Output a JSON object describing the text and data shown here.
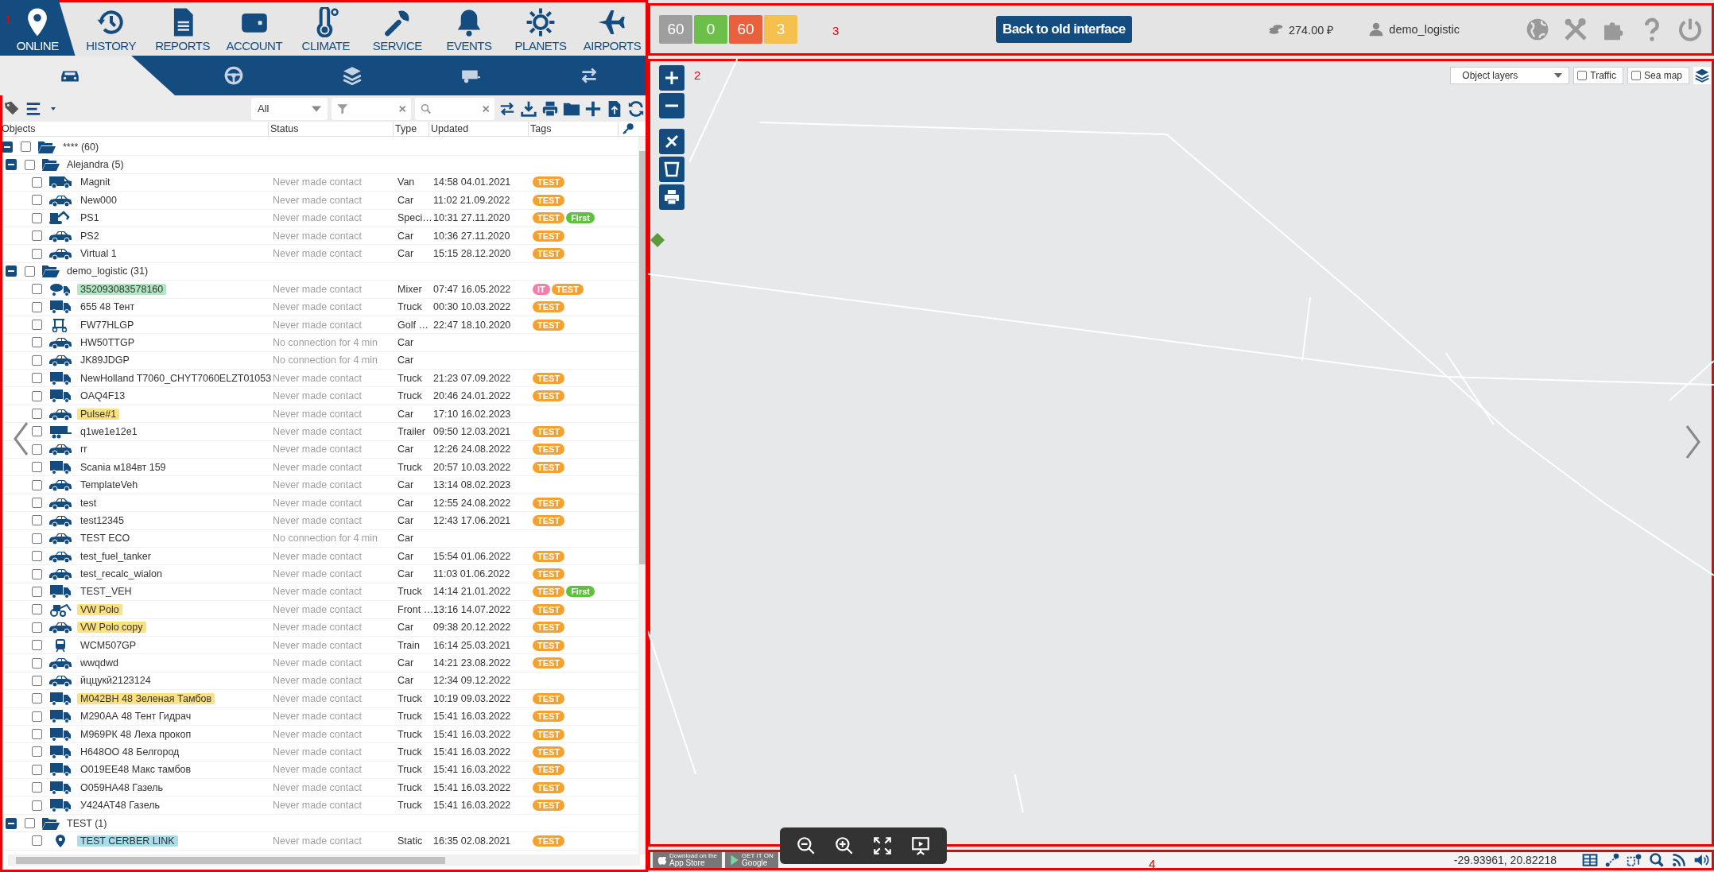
{
  "left_panel": {
    "annotation": "1",
    "nav": [
      {
        "label": "ONLINE",
        "selected": true
      },
      {
        "label": "HISTORY",
        "selected": false
      },
      {
        "label": "REPORTS",
        "selected": false
      },
      {
        "label": "ACCOUNT",
        "selected": false
      },
      {
        "label": "CLIMATE",
        "selected": false
      },
      {
        "label": "SERVICE",
        "selected": false
      },
      {
        "label": "EVENTS",
        "selected": false
      },
      {
        "label": "PLANETS",
        "selected": false
      },
      {
        "label": "AIRPORTS",
        "selected": false
      }
    ],
    "sub_tabs": [
      {
        "selected": true
      },
      {
        "selected": false
      },
      {
        "selected": false
      },
      {
        "selected": false
      },
      {
        "selected": false
      }
    ],
    "filter_select": {
      "value": "All"
    },
    "columns": [
      "Objects",
      "Status",
      "Type",
      "Updated",
      "Tags"
    ],
    "object_tree": [
      {
        "kind": "group",
        "name": "**** (60)",
        "expanded": true,
        "checked": false,
        "children": [
          {
            "kind": "group",
            "name": "Alejandra (5)",
            "expanded": true,
            "checked": false,
            "children": [
              {
                "kind": "van",
                "name": "Magnit",
                "checked": false,
                "status": "Never made contact",
                "type": "Van",
                "updated": "14:58 04.01.2021",
                "tags": [
                  {
                    "label": "TEST",
                    "color": "#f5a130"
                  }
                ]
              },
              {
                "kind": "car",
                "name": "New000",
                "checked": false,
                "status": "Never made contact",
                "type": "Car",
                "updated": "11:02 21.09.2022",
                "tags": [
                  {
                    "label": "TEST",
                    "color": "#f5a130"
                  }
                ]
              },
              {
                "kind": "excavator",
                "name": "PS1",
                "checked": false,
                "status": "Never made contact",
                "type": "Speci…",
                "updated": "10:31 27.11.2020",
                "tags": [
                  {
                    "label": "TEST",
                    "color": "#f5a130"
                  },
                  {
                    "label": "First",
                    "color": "#5cc23b"
                  }
                ]
              },
              {
                "kind": "car",
                "name": "PS2",
                "checked": false,
                "status": "Never made contact",
                "type": "Car",
                "updated": "10:36 27.11.2020",
                "tags": [
                  {
                    "label": "TEST",
                    "color": "#f5a130"
                  }
                ]
              },
              {
                "kind": "car",
                "name": "Virtual 1",
                "checked": false,
                "status": "Never made contact",
                "type": "Car",
                "updated": "15:15 28.12.2020",
                "tags": [
                  {
                    "label": "TEST",
                    "color": "#f5a130"
                  }
                ]
              }
            ]
          },
          {
            "kind": "group",
            "name": "demo_logistic (31)",
            "expanded": true,
            "checked": false,
            "children": [
              {
                "kind": "mixer",
                "name": "352093083578160",
                "color": "#b3e6c3",
                "checked": false,
                "status": "Never made contact",
                "type": "Mixer",
                "updated": "07:47 16.05.2022",
                "tags": [
                  {
                    "label": "IT",
                    "color": "#f27fa6"
                  },
                  {
                    "label": "TEST",
                    "color": "#f5a130"
                  }
                ]
              },
              {
                "kind": "truck",
                "name": "655 48 Тент",
                "checked": false,
                "status": "Never made contact",
                "type": "Truck",
                "updated": "00:30 10.03.2022",
                "tags": [
                  {
                    "label": "TEST",
                    "color": "#f5a130"
                  }
                ]
              },
              {
                "kind": "golf",
                "name": "FW77HLGP",
                "checked": false,
                "status": "Never made contact",
                "type": "Golf …",
                "updated": "22:47 18.10.2020",
                "tags": [
                  {
                    "label": "TEST",
                    "color": "#f5a130"
                  }
                ]
              },
              {
                "kind": "car",
                "name": "HW50TTGP",
                "checked": false,
                "status": "No connection for 4 min",
                "type": "Car"
              },
              {
                "kind": "car",
                "name": "JK89JDGP",
                "checked": false,
                "status": "No connection for 4 min",
                "type": "Car"
              },
              {
                "kind": "truck",
                "name": "NewHolland T7060_CHYT7060ELZT01053",
                "checked": false,
                "status": "Never made contact",
                "type": "Truck",
                "updated": "21:23 07.09.2022",
                "tags": [
                  {
                    "label": "TEST",
                    "color": "#f5a130"
                  }
                ]
              },
              {
                "kind": "truck",
                "name": "OAQ4F13",
                "checked": false,
                "status": "Never made contact",
                "type": "Truck",
                "updated": "20:46 24.01.2022",
                "tags": [
                  {
                    "label": "TEST",
                    "color": "#f5a130"
                  }
                ]
              },
              {
                "kind": "car",
                "name": "Pulse#1",
                "color": "#fbe27f",
                "checked": false,
                "status": "Never made contact",
                "type": "Car",
                "updated": "17:10 16.02.2023"
              },
              {
                "kind": "trailer",
                "name": "q1we1e12e1",
                "checked": false,
                "status": "Never made contact",
                "type": "Trailer",
                "updated": "09:50 12.03.2021",
                "tags": [
                  {
                    "label": "TEST",
                    "color": "#f5a130"
                  }
                ]
              },
              {
                "kind": "car",
                "name": "rr",
                "checked": false,
                "status": "Never made contact",
                "type": "Car",
                "updated": "12:26 24.08.2022",
                "tags": [
                  {
                    "label": "TEST",
                    "color": "#f5a130"
                  }
                ]
              },
              {
                "kind": "truck",
                "name": "Scania м184вт 159",
                "checked": false,
                "status": "Never made contact",
                "type": "Truck",
                "updated": "20:57 10.03.2022",
                "tags": [
                  {
                    "label": "TEST",
                    "color": "#f5a130"
                  }
                ]
              },
              {
                "kind": "car",
                "name": "TemplateVeh",
                "checked": false,
                "status": "Never made contact",
                "type": "Car",
                "updated": "13:14 08.02.2023"
              },
              {
                "kind": "car",
                "name": "test",
                "checked": false,
                "status": "Never made contact",
                "type": "Car",
                "updated": "12:55 24.08.2022",
                "tags": [
                  {
                    "label": "TEST",
                    "color": "#f5a130"
                  }
                ]
              },
              {
                "kind": "car",
                "name": "test12345",
                "checked": false,
                "status": "Never made contact",
                "type": "Car",
                "updated": "12:43 17.06.2021",
                "tags": [
                  {
                    "label": "TEST",
                    "color": "#f5a130"
                  }
                ]
              },
              {
                "kind": "car",
                "name": "TEST ECO",
                "checked": false,
                "status": "No connection for 4 min",
                "type": "Car"
              },
              {
                "kind": "car",
                "name": "test_fuel_tanker",
                "checked": false,
                "status": "Never made contact",
                "type": "Car",
                "updated": "15:54 01.06.2022",
                "tags": [
                  {
                    "label": "TEST",
                    "color": "#f5a130"
                  }
                ]
              },
              {
                "kind": "car",
                "name": "test_recalc_wialon",
                "checked": false,
                "status": "Never made contact",
                "type": "Car",
                "updated": "11:03 01.06.2022",
                "tags": [
                  {
                    "label": "TEST",
                    "color": "#f5a130"
                  }
                ]
              },
              {
                "kind": "truck",
                "name": "TEST_VEH",
                "checked": false,
                "status": "Never made contact",
                "type": "Truck",
                "updated": "14:14 21.01.2022",
                "tags": [
                  {
                    "label": "TEST",
                    "color": "#f5a130"
                  },
                  {
                    "label": "First",
                    "color": "#5cc23b"
                  }
                ]
              },
              {
                "kind": "loader",
                "name": "VW Polo",
                "color": "#fbe27f",
                "checked": false,
                "status": "Never made contact",
                "type": "Front …",
                "updated": "13:16 14.07.2022",
                "tags": [
                  {
                    "label": "TEST",
                    "color": "#f5a130"
                  }
                ]
              },
              {
                "kind": "car",
                "name": "VW Polo copy",
                "color": "#fbe27f",
                "checked": false,
                "status": "Never made contact",
                "type": "Car",
                "updated": "09:38 20.12.2022",
                "tags": [
                  {
                    "label": "TEST",
                    "color": "#f5a130"
                  }
                ]
              },
              {
                "kind": "train",
                "name": "WCM507GP",
                "checked": false,
                "status": "Never made contact",
                "type": "Train",
                "updated": "16:14 25.03.2021",
                "tags": [
                  {
                    "label": "TEST",
                    "color": "#f5a130"
                  }
                ]
              },
              {
                "kind": "car",
                "name": "wwqdwd",
                "checked": false,
                "status": "Never made contact",
                "type": "Car",
                "updated": "14:21 23.08.2022",
                "tags": [
                  {
                    "label": "TEST",
                    "color": "#f5a130"
                  }
                ]
              },
              {
                "kind": "car",
                "name": "йццукй2123124",
                "checked": false,
                "status": "Never made contact",
                "type": "Car",
                "updated": "12:34 09.12.2022"
              },
              {
                "kind": "truck",
                "name": "М042ВН 48 Зеленая Тамбов",
                "color": "#fbe27f",
                "checked": false,
                "status": "Never made contact",
                "type": "Truck",
                "updated": "10:19 09.03.2022",
                "tags": [
                  {
                    "label": "TEST",
                    "color": "#f5a130"
                  }
                ]
              },
              {
                "kind": "truck",
                "name": "М290АА 48 Тент Гидрач",
                "checked": false,
                "status": "Never made contact",
                "type": "Truck",
                "updated": "15:41 16.03.2022",
                "tags": [
                  {
                    "label": "TEST",
                    "color": "#f5a130"
                  }
                ]
              },
              {
                "kind": "truck",
                "name": "М969РК 48 Леха прокоп",
                "checked": false,
                "status": "Never made contact",
                "type": "Truck",
                "updated": "15:41 16.03.2022",
                "tags": [
                  {
                    "label": "TEST",
                    "color": "#f5a130"
                  }
                ]
              },
              {
                "kind": "truck",
                "name": "Н648ОО 48 Белгород",
                "checked": false,
                "status": "Never made contact",
                "type": "Truck",
                "updated": "15:41 16.03.2022",
                "tags": [
                  {
                    "label": "TEST",
                    "color": "#f5a130"
                  }
                ]
              },
              {
                "kind": "truck",
                "name": "О019ЕЕ48 Макс тамбов",
                "checked": false,
                "status": "Never made contact",
                "type": "Truck",
                "updated": "15:41 16.03.2022",
                "tags": [
                  {
                    "label": "TEST",
                    "color": "#f5a130"
                  }
                ]
              },
              {
                "kind": "truck",
                "name": "О059НА48 Газель",
                "checked": false,
                "status": "Never made contact",
                "type": "Truck",
                "updated": "15:41 16.03.2022",
                "tags": [
                  {
                    "label": "TEST",
                    "color": "#f5a130"
                  }
                ]
              },
              {
                "kind": "truck",
                "name": "У424АТ48 Газель",
                "checked": false,
                "status": "Never made contact",
                "type": "Truck",
                "updated": "15:41 16.03.2022",
                "tags": [
                  {
                    "label": "TEST",
                    "color": "#f5a130"
                  }
                ]
              }
            ]
          },
          {
            "kind": "group",
            "name": "TEST (1)",
            "expanded": true,
            "checked": false,
            "children": [
              {
                "kind": "pin",
                "name": "TEST CERBER LINK",
                "color": "#a9dcec",
                "checked": false,
                "status": "Never made contact",
                "type": "Static",
                "updated": "16:35 02.08.2021",
                "tags": [
                  {
                    "label": "TEST",
                    "color": "#f5a130"
                  }
                ]
              }
            ]
          }
        ]
      }
    ]
  },
  "top_bar": {
    "annotation": "3",
    "counters": [
      {
        "label": "60",
        "color": "#9e9e9e"
      },
      {
        "label": "0",
        "color": "#6cc04a"
      },
      {
        "label": "60",
        "color": "#e8613c"
      },
      {
        "label": "3",
        "color": "#f6c04e"
      }
    ],
    "back_button": "Back to old interface",
    "balance": "274.00 ₽",
    "user": "demo_logistic"
  },
  "map": {
    "annotation": "2",
    "layers_select": {
      "value": "Object layers"
    },
    "toggles": [
      {
        "label": "Traffic",
        "checked": false
      },
      {
        "label": "Sea map",
        "checked": false
      }
    ]
  },
  "bottom_bar": {
    "annotation": "4",
    "store_badges": [
      {
        "kind": "apple",
        "line1": "Download on the",
        "line2": "App Store"
      },
      {
        "kind": "google",
        "line1": "GET IT ON",
        "line2": "Google"
      }
    ],
    "coordinates": "-29.93961, 20.82218"
  }
}
